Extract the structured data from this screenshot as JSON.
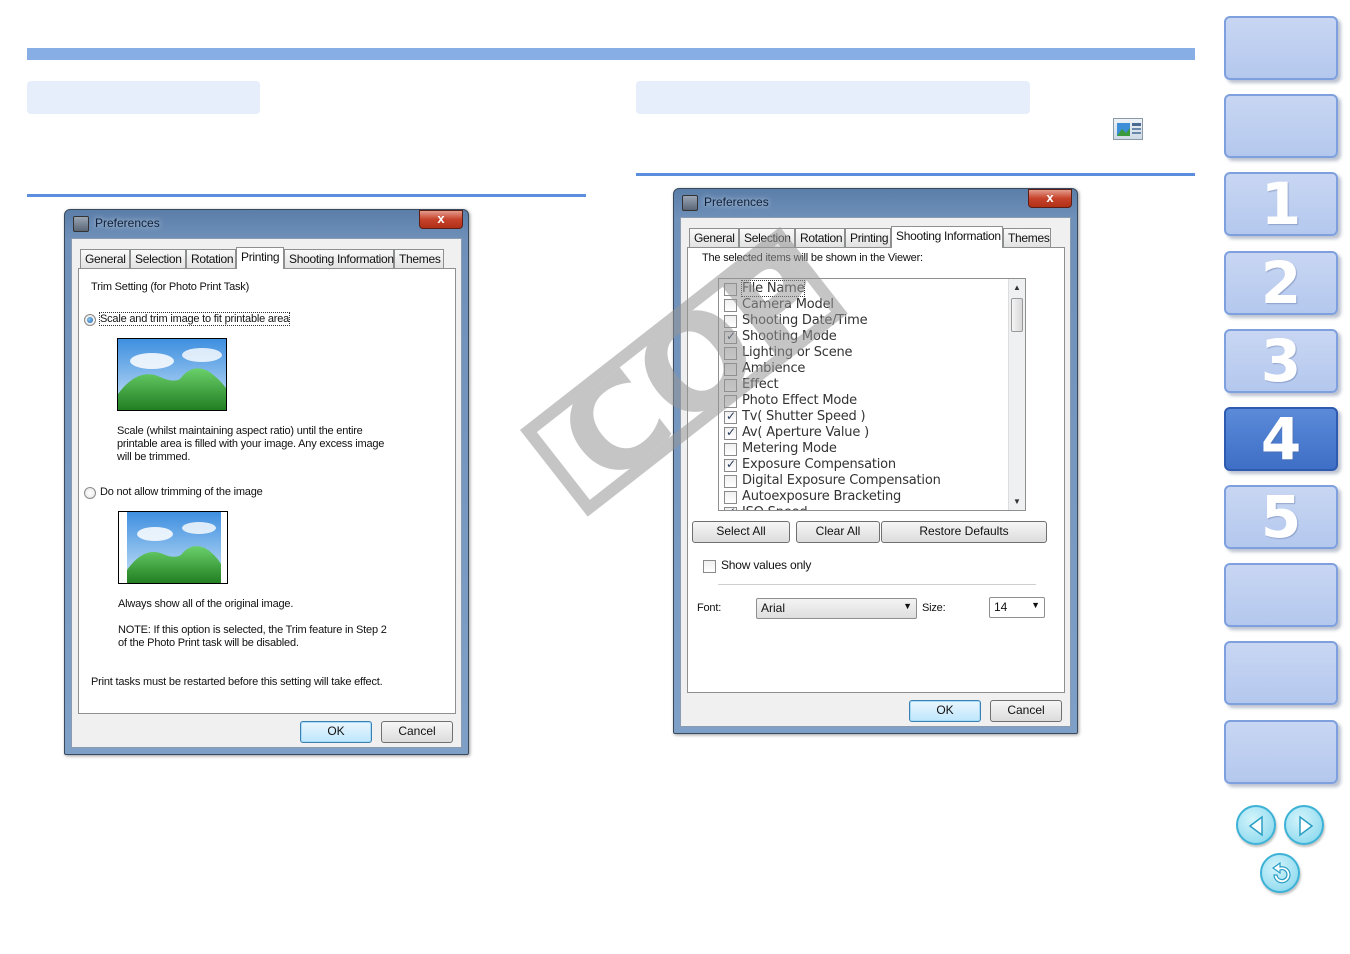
{
  "nav": {
    "chapters": [
      "1",
      "2",
      "3",
      "4",
      "5"
    ],
    "active_chapter": "4"
  },
  "left_dialog": {
    "title": "Preferences",
    "close": "x",
    "tabs": [
      "General",
      "Selection",
      "Rotation",
      "Printing",
      "Shooting Information",
      "Themes"
    ],
    "active_tab": "Printing",
    "trim_heading": "Trim Setting (for Photo Print Task)",
    "option1_label": "Scale and trim image to fit printable area",
    "option1_desc": [
      "Scale (whilst maintaining aspect ratio) until the entire",
      "printable area is filled with your image. Any excess image",
      "will be trimmed."
    ],
    "option2_label": "Do not allow trimming of the image",
    "option2_desc": "Always show all of the original image.",
    "option2_note": [
      "NOTE: If this option is selected, the Trim feature in Step 2",
      "of the Photo Print task will be disabled."
    ],
    "restart_note": "Print tasks must be restarted before this setting will take effect.",
    "ok": "OK",
    "cancel": "Cancel"
  },
  "right_dialog": {
    "title": "Preferences",
    "close": "x",
    "tabs": [
      "General",
      "Selection",
      "Rotation",
      "Printing",
      "Shooting Information",
      "Themes"
    ],
    "active_tab": "Shooting Information",
    "intro": "The selected items will be shown in the Viewer:",
    "items": [
      {
        "label": "File Name",
        "checked": false
      },
      {
        "label": "Camera Model",
        "checked": false
      },
      {
        "label": "Shooting Date/Time",
        "checked": false
      },
      {
        "label": "Shooting Mode",
        "checked": true
      },
      {
        "label": "Lighting or Scene",
        "checked": false
      },
      {
        "label": "Ambience",
        "checked": false
      },
      {
        "label": "Effect",
        "checked": false
      },
      {
        "label": "Photo Effect Mode",
        "checked": false
      },
      {
        "label": "Tv( Shutter Speed )",
        "checked": true
      },
      {
        "label": "Av( Aperture Value )",
        "checked": true
      },
      {
        "label": "Metering Mode",
        "checked": false
      },
      {
        "label": "Exposure Compensation",
        "checked": true
      },
      {
        "label": "Digital Exposure Compensation",
        "checked": false
      },
      {
        "label": "Autoexposure Bracketing",
        "checked": false
      },
      {
        "label": "ISO Speed",
        "checked": true
      }
    ],
    "select_all": "Select All",
    "clear_all": "Clear All",
    "restore_defaults": "Restore Defaults",
    "show_values_only": "Show values only",
    "font_label": "Font:",
    "font_value": "Arial",
    "size_label": "Size:",
    "size_value": "14",
    "ok": "OK",
    "cancel": "Cancel"
  },
  "watermark": "COPY",
  "colors": {
    "accent": "#5b8fdd",
    "nav_button": "#b4c8ee",
    "nav_active": "#3e6fc6"
  }
}
